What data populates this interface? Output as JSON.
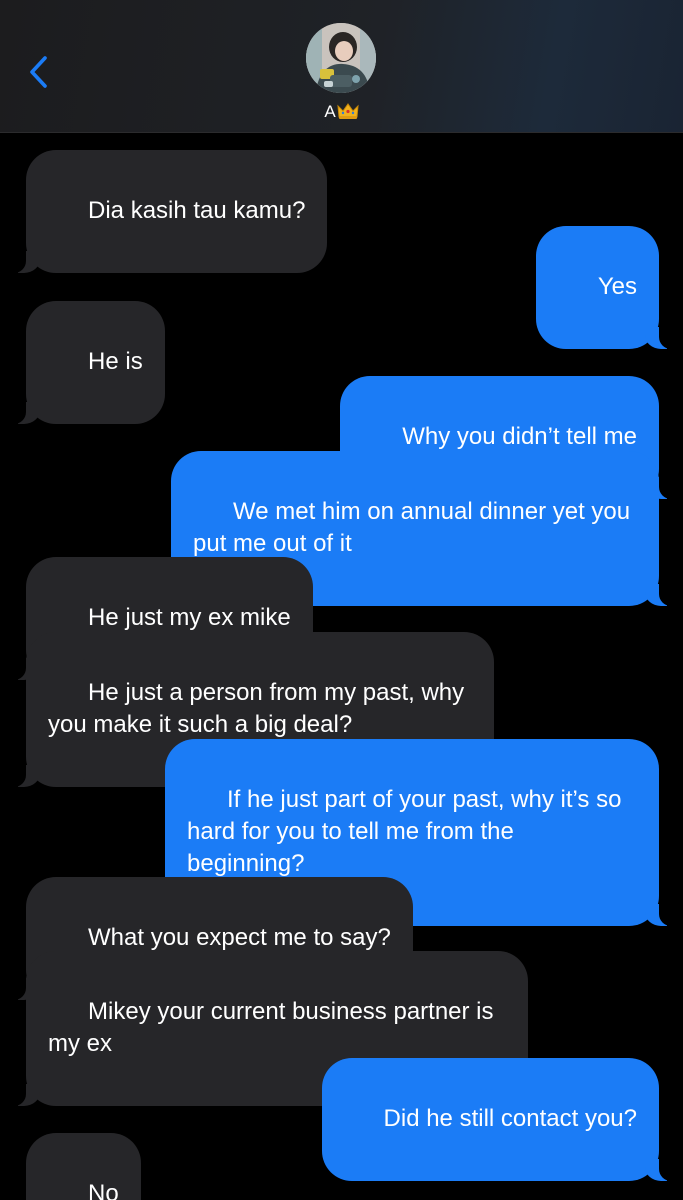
{
  "header": {
    "back_icon": "chevron-left-icon",
    "contact_name": "A",
    "contact_emoji": "crown-icon",
    "accent_color": "#1b7cf6"
  },
  "messages": [
    {
      "direction": "incoming",
      "text": "Dia kasih tau kamu?"
    },
    {
      "direction": "outgoing",
      "text": "Yes"
    },
    {
      "direction": "incoming",
      "text": "He is"
    },
    {
      "direction": "outgoing",
      "text": "Why you didn’t tell me"
    },
    {
      "direction": "outgoing",
      "text": "We met him on annual dinner yet you put me out of it"
    },
    {
      "direction": "incoming",
      "text": "He just my ex mike"
    },
    {
      "direction": "incoming",
      "text": "He just a person from my past, why you make it such a big deal?"
    },
    {
      "direction": "outgoing",
      "text": "If he just part of your past, why it’s so hard for you to tell me from the beginning?"
    },
    {
      "direction": "incoming",
      "text": "What you expect me to say?"
    },
    {
      "direction": "incoming",
      "text": "Mikey your current business partner is my ex"
    },
    {
      "direction": "outgoing",
      "text": "Did he still contact you?"
    },
    {
      "direction": "incoming",
      "text": "No"
    }
  ]
}
